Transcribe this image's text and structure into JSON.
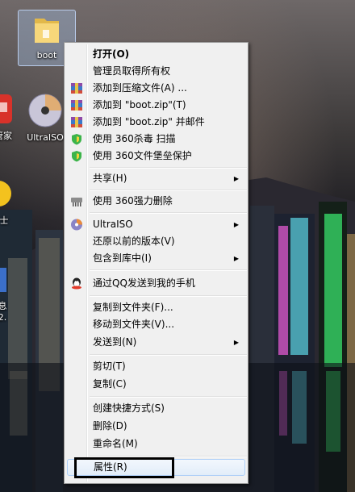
{
  "desktop": {
    "icons": [
      {
        "label": "boot",
        "icon": "folder-icon",
        "selected": true
      },
      {
        "label": "UltraISO",
        "icon": "disc-icon"
      },
      {
        "label": "管家",
        "icon": "app-icon"
      },
      {
        "label": "士",
        "icon": "app-icon"
      },
      {
        "label": "息",
        "icon": "app-icon"
      },
      {
        "label": "2.",
        "icon": "app-icon"
      }
    ]
  },
  "context_menu": {
    "items": [
      {
        "label": "打开(O)",
        "bold": true
      },
      {
        "label": "管理员取得所有权"
      },
      {
        "label": "添加到压缩文件(A) ...",
        "icon": "winrar-icon"
      },
      {
        "label": "添加到 \"boot.zip\"(T)",
        "icon": "winrar-icon"
      },
      {
        "label": "添加到 \"boot.zip\" 并邮件",
        "icon": "winrar-icon"
      },
      {
        "label": "使用 360杀毒 扫描",
        "icon": "360-shield-icon"
      },
      {
        "label": "使用 360文件堡垒保护",
        "icon": "360-shield-icon"
      },
      {
        "label": "共享(H)",
        "submenu": true
      },
      {
        "label": "使用 360强力删除",
        "icon": "shredder-icon"
      },
      {
        "label": "UltraISO",
        "icon": "disc-icon",
        "submenu": true
      },
      {
        "label": "还原以前的版本(V)"
      },
      {
        "label": "包含到库中(I)",
        "submenu": true
      },
      {
        "label": "通过QQ发送到我的手机",
        "icon": "qq-icon"
      },
      {
        "label": "复制到文件夹(F)..."
      },
      {
        "label": "移动到文件夹(V)..."
      },
      {
        "label": "发送到(N)",
        "submenu": true
      },
      {
        "label": "剪切(T)"
      },
      {
        "label": "复制(C)"
      },
      {
        "label": "创建快捷方式(S)"
      },
      {
        "label": "删除(D)"
      },
      {
        "label": "重命名(M)"
      },
      {
        "label": "属性(R)",
        "highlighted": true
      }
    ]
  }
}
